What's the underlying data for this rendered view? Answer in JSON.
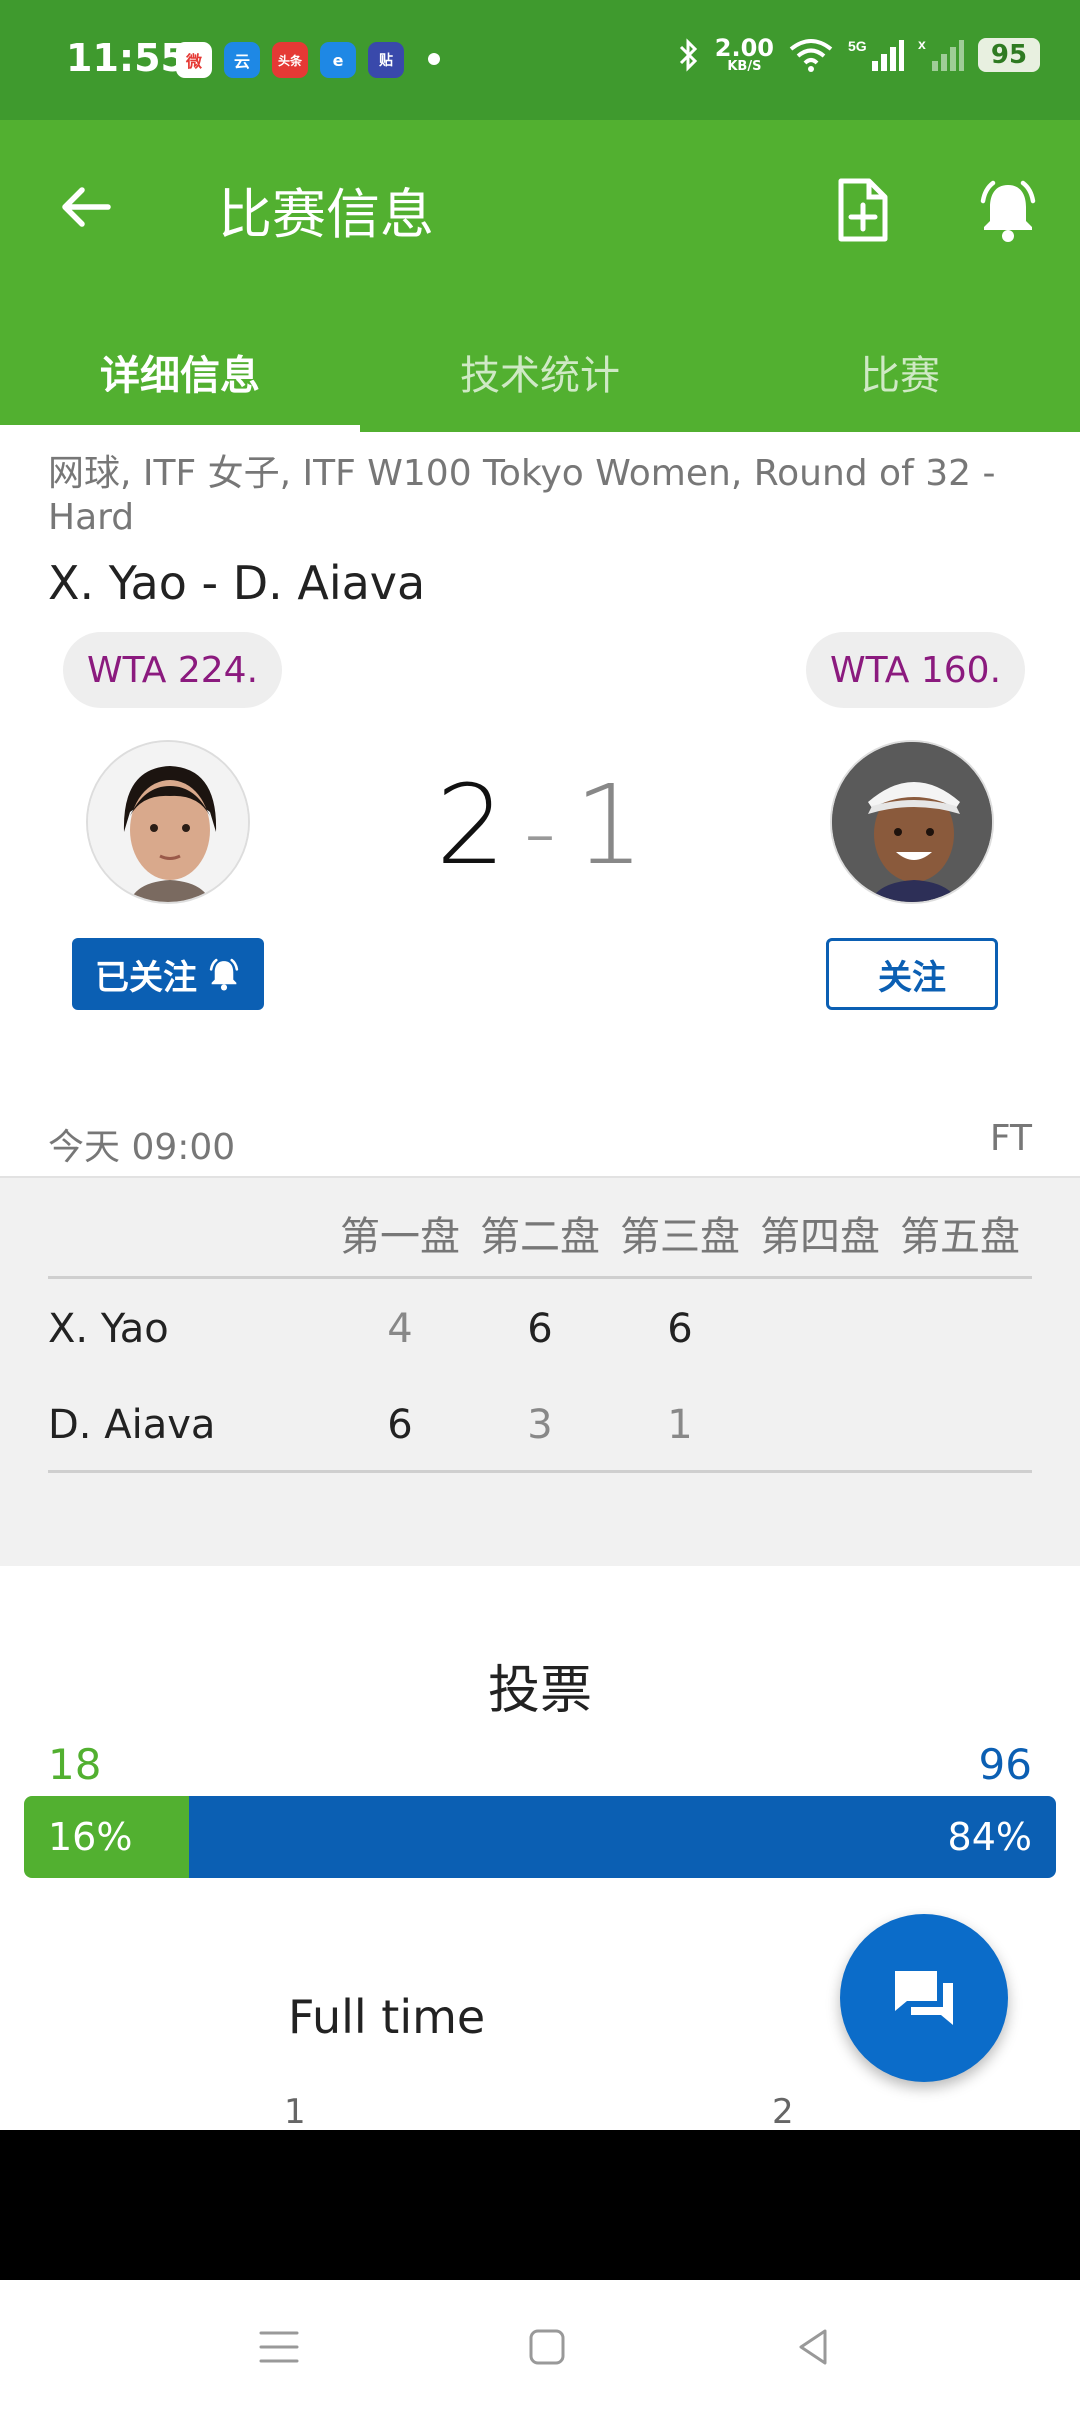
{
  "status_bar": {
    "time": "11:55",
    "apps": [
      "微",
      "云",
      "头条",
      "e",
      "贴"
    ],
    "net_speed": "2.00",
    "net_unit": "KB/S",
    "network": "5G",
    "battery": "95"
  },
  "app_bar": {
    "title": "比赛信息",
    "tabs": [
      {
        "label": "详细信息",
        "active": true
      },
      {
        "label": "技术统计",
        "active": false
      },
      {
        "label": "比赛",
        "active": false
      }
    ]
  },
  "match": {
    "subtitle": "网球, ITF 女子, ITF W100 Tokyo Women, Round of 32 - Hard",
    "name": "X. Yao - D. Aiava",
    "home_rank": "WTA 224.",
    "away_rank": "WTA 160.",
    "home_score": "2",
    "separator": "-",
    "away_score": "1",
    "home_follow": "已关注",
    "away_follow": "关注",
    "datetime": "今天 09:00",
    "status": "FT"
  },
  "sets_table": {
    "headers": [
      "第一盘",
      "第二盘",
      "第三盘",
      "第四盘",
      "第五盘"
    ],
    "rows": [
      {
        "player": "X. Yao",
        "sets": [
          "4",
          "6",
          "6"
        ]
      },
      {
        "player": "D. Aiava",
        "sets": [
          "6",
          "3",
          "1"
        ]
      }
    ]
  },
  "votes": {
    "title": "投票",
    "home_count": "18",
    "away_count": "96",
    "home_pct": "16%",
    "away_pct": "84%",
    "home_fraction": 0.16,
    "home_color": "#52b030",
    "away_color": "#0b5fb3"
  },
  "full_time": {
    "label": "Full time",
    "col1": "1",
    "col2": "2"
  },
  "colors": {
    "status_bar": "#3f9a2e",
    "app_bar": "#52b030",
    "accent_blue": "#0b5fb3",
    "rank_text": "#8b1a7e"
  }
}
